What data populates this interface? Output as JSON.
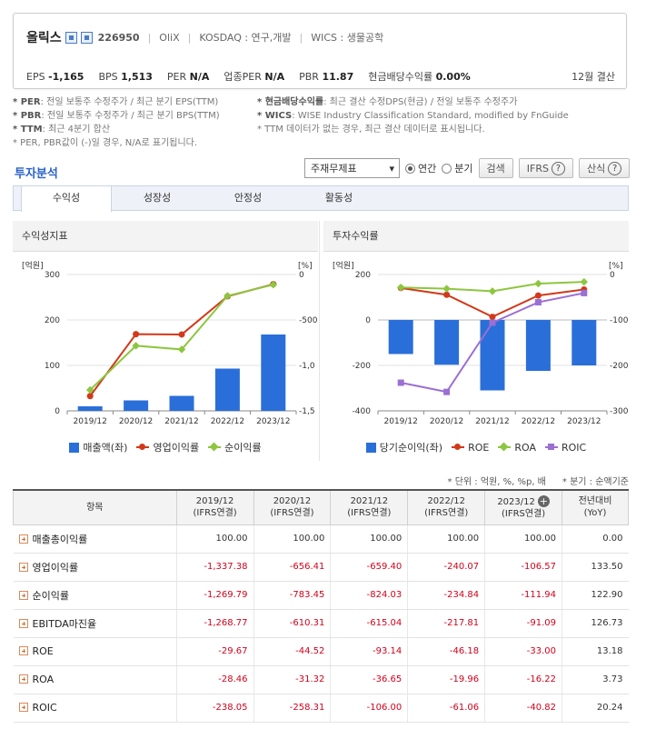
{
  "company": {
    "name": "올릭스",
    "code": "226950",
    "en_name": "OliX",
    "market": "KOSDAQ : 연구,개발",
    "wics": "WICS : 생물공학"
  },
  "metrics": [
    {
      "label": "EPS",
      "value": "-1,165"
    },
    {
      "label": "BPS",
      "value": "1,513"
    },
    {
      "label": "PER",
      "value": "N/A"
    },
    {
      "label": "업종PER",
      "value": "N/A"
    },
    {
      "label": "PBR",
      "value": "11.87"
    },
    {
      "label": "현금배당수익률",
      "value": "0.00%"
    }
  ],
  "fiscal": "12월 결산",
  "notes_left": [
    {
      "key": "* PER",
      "text": ": 전일 보통주 수정주가 / 최근 분기 EPS(TTM)"
    },
    {
      "key": "* PBR",
      "text": ": 전일 보통주 수정주가 / 최근 분기 BPS(TTM)"
    },
    {
      "key": "* TTM",
      "text": ": 최근 4분기 합산"
    },
    {
      "key": "",
      "text": "* PER, PBR값이 (-)일 경우, N/A로 표기됩니다."
    }
  ],
  "notes_right": [
    {
      "key": "* 현금배당수익률",
      "text": ": 최근 결산 수정DPS(현금) / 전일 보통주 수정주가"
    },
    {
      "key": "* WICS",
      "text": ": WISE Industry Classification Standard, modified by FnGuide"
    },
    {
      "key": "",
      "text": "* TTM 데이터가 없는 경우, 최근 결산 데이터로 표시됩니다."
    }
  ],
  "section_title": "투자분석",
  "controls": {
    "select_value": "주재무제표",
    "radio_annual": "연간",
    "radio_quarter": "분기",
    "search": "검색",
    "ifrs": "IFRS",
    "calc": "산식",
    "q": "?"
  },
  "tabs": [
    "수익성",
    "성장성",
    "안정성",
    "활동성"
  ],
  "panels": {
    "left_title": "수익성지표",
    "right_title": "투자수익률"
  },
  "units_note": "* 단위 : 억원, %, %p, 배",
  "quarter_note": "* 분기 : 순액기준",
  "table": {
    "header_item": "항목",
    "columns": [
      {
        "year": "2019/12",
        "sub": "(IFRS연결)"
      },
      {
        "year": "2020/12",
        "sub": "(IFRS연결)"
      },
      {
        "year": "2021/12",
        "sub": "(IFRS연결)"
      },
      {
        "year": "2022/12",
        "sub": "(IFRS연결)"
      },
      {
        "year": "2023/12",
        "sub": "(IFRS연결)"
      }
    ],
    "yoy_label": "전년대비",
    "yoy_sub": "(YoY)",
    "rows": [
      {
        "label": "매출총이익률",
        "values": [
          "100.00",
          "100.00",
          "100.00",
          "100.00",
          "100.00"
        ],
        "yoy": "0.00"
      },
      {
        "label": "영업이익률",
        "values": [
          "-1,337.38",
          "-656.41",
          "-659.40",
          "-240.07",
          "-106.57"
        ],
        "yoy": "133.50"
      },
      {
        "label": "순이익률",
        "values": [
          "-1,269.79",
          "-783.45",
          "-824.03",
          "-234.84",
          "-111.94"
        ],
        "yoy": "122.90"
      },
      {
        "label": "EBITDA마진율",
        "values": [
          "-1,268.77",
          "-610.31",
          "-615.04",
          "-217.81",
          "-91.09"
        ],
        "yoy": "126.73"
      },
      {
        "label": "ROE",
        "values": [
          "-29.67",
          "-44.52",
          "-93.14",
          "-46.18",
          "-33.00"
        ],
        "yoy": "13.18"
      },
      {
        "label": "ROA",
        "values": [
          "-28.46",
          "-31.32",
          "-36.65",
          "-19.96",
          "-16.22"
        ],
        "yoy": "3.73"
      },
      {
        "label": "ROIC",
        "values": [
          "-238.05",
          "-258.31",
          "-106.00",
          "-61.06",
          "-40.82"
        ],
        "yoy": "20.24"
      }
    ]
  },
  "chart_data": [
    {
      "type": "bar+line",
      "title": "수익성지표",
      "categories": [
        "2019/12",
        "2020/12",
        "2021/12",
        "2022/12",
        "2023/12"
      ],
      "left_unit": "[억원]",
      "right_unit": "[%]",
      "left_ticks": [
        "300",
        "200",
        "100",
        "0"
      ],
      "right_ticks": [
        "0",
        "-500",
        "-1,0",
        "-1,5"
      ],
      "ylim_left": [
        0,
        300
      ],
      "ylim_right": [
        -1500,
        0
      ],
      "grid": true,
      "legend_position": "bottom",
      "colors": {
        "bar": "#2a6fd9",
        "op": "#d2391a",
        "net": "#8dc63f"
      },
      "series": [
        {
          "name": "매출액(좌)",
          "axis": "left",
          "kind": "bar",
          "values": [
            10,
            23,
            33,
            93,
            168
          ]
        },
        {
          "name": "영업이익률",
          "axis": "right",
          "kind": "line",
          "values": [
            -1337.38,
            -656.41,
            -659.4,
            -240.07,
            -106.57
          ]
        },
        {
          "name": "순이익률",
          "axis": "right",
          "kind": "line",
          "values": [
            -1269.79,
            -783.45,
            -824.03,
            -234.84,
            -111.94
          ]
        }
      ]
    },
    {
      "type": "bar+line",
      "title": "투자수익률",
      "categories": [
        "2019/12",
        "2020/12",
        "2021/12",
        "2022/12",
        "2023/12"
      ],
      "left_unit": "[억원]",
      "right_unit": "[%]",
      "left_ticks": [
        "200",
        "0",
        "-200",
        "-400"
      ],
      "right_ticks": [
        "0",
        "-100",
        "-200",
        "-300"
      ],
      "ylim_left": [
        -400,
        200
      ],
      "ylim_right": [
        -300,
        0
      ],
      "grid": true,
      "legend_position": "bottom",
      "colors": {
        "bar": "#2a6fd9",
        "roe": "#d2391a",
        "roa": "#8dc63f",
        "roic": "#9b6fd3"
      },
      "series": [
        {
          "name": "당기순이익(좌)",
          "axis": "left",
          "kind": "bar",
          "values": [
            -150,
            -197,
            -310,
            -224,
            -200
          ]
        },
        {
          "name": "ROE",
          "axis": "right",
          "kind": "line",
          "values": [
            -29.67,
            -44.52,
            -93.14,
            -46.18,
            -33.0
          ]
        },
        {
          "name": "ROA",
          "axis": "right",
          "kind": "line",
          "values": [
            -28.46,
            -31.32,
            -36.65,
            -19.96,
            -16.22
          ]
        },
        {
          "name": "ROIC",
          "axis": "right",
          "kind": "line",
          "values": [
            -238.05,
            -258.31,
            -106.0,
            -61.06,
            -40.82
          ]
        }
      ]
    }
  ]
}
